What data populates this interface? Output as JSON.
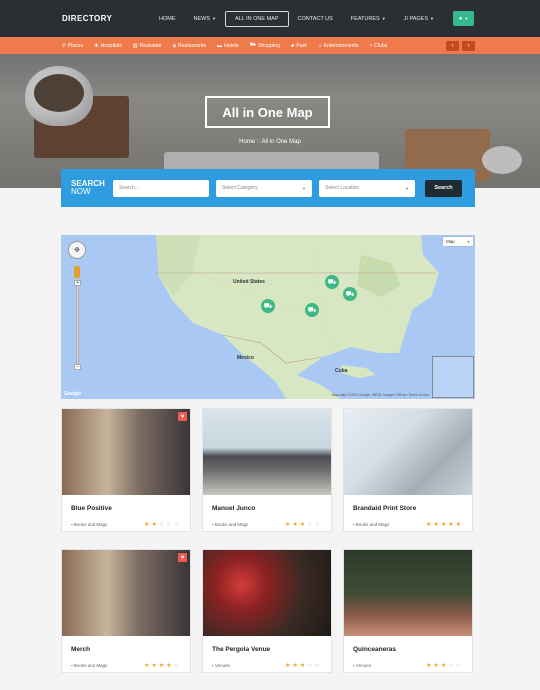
{
  "brand": "DIRECTORY",
  "nav": {
    "home": "HOME",
    "news": "NEWS",
    "map": "ALL IN ONE MAP",
    "contact": "CONTACT US",
    "features": "FEATURES",
    "jipages": "JI PAGES"
  },
  "categories": [
    {
      "label": "Places"
    },
    {
      "label": "Hospitals"
    },
    {
      "label": "Realstate"
    },
    {
      "label": "Restaurants"
    },
    {
      "label": "Hotels"
    },
    {
      "label": "Shopping"
    },
    {
      "label": "Park"
    },
    {
      "label": "Entertainments"
    },
    {
      "label": "Clubs"
    }
  ],
  "hero": {
    "title": "All in One Map",
    "breadcrumb": "Home :: All in One Map"
  },
  "search": {
    "label_line1": "SEARCH",
    "label_line2": "NOW",
    "placeholder": "Search...",
    "category": "Select Category",
    "location": "Select Location",
    "button": "Search"
  },
  "map": {
    "type": "Map",
    "labels": {
      "us": "United States",
      "mexico": "Mexico",
      "cuba": "Cuba"
    },
    "footer": "Map data ©2015 Google, INEGI, Imagen   200 km   Terms of Use",
    "logo": "Google"
  },
  "listings": [
    {
      "title": "Blue Positive",
      "category": "Books and Mags",
      "rating": 2
    },
    {
      "title": "Manuel Junco",
      "category": "Books and Mags",
      "rating": 3
    },
    {
      "title": "Brandaid Print Store",
      "category": "Books and Mags",
      "rating": 5
    },
    {
      "title": "Merch",
      "category": "Books and Mags",
      "rating": 4
    },
    {
      "title": "The Pergola Venue",
      "category": "Venues",
      "rating": 3
    },
    {
      "title": "Quinceaneras",
      "category": "Venues",
      "rating": 3
    }
  ],
  "colors": {
    "accent": "#ef7b4c",
    "search": "#2f9ce0",
    "nav": "#2b2f33",
    "star": "#f0a31c",
    "pin": "#41b883"
  }
}
